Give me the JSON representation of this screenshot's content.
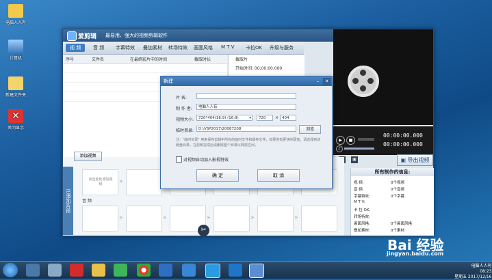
{
  "desktop": {
    "icons": [
      {
        "label": "电脑人人有",
        "name": "desktop-icon-folder"
      },
      {
        "label": "计算机",
        "name": "desktop-icon-computer"
      },
      {
        "label": "新建文件夹",
        "name": "desktop-icon-new-folder"
      },
      {
        "label": "关闭显示",
        "name": "desktop-icon-close-display"
      }
    ]
  },
  "app": {
    "title": "爱剪辑",
    "slogan": "最易用、强大的视频剪辑软件",
    "menu": [
      "视 频",
      "音 频",
      "字幕特效",
      "叠加素材",
      "转场特效",
      "画面风格",
      "M T V",
      "卡拉OK",
      "升级与服务"
    ],
    "table_headers": [
      "序号",
      "文件名",
      "在最终影片中的时间",
      "截取时长"
    ],
    "right_panel_title": "截取片",
    "right_panel_start": "开始时间: 00:00:00.000",
    "time_current": "00:00:00.000",
    "time_total": "00:00:00.000",
    "export_label": "导出视频",
    "add_video": "添加视频",
    "side_tab": "已添加片段",
    "thumb_hint": "双击此处添加视频",
    "music_label": "音 频",
    "info_title": "所有制作的信息:",
    "info_rows": [
      {
        "k": "视     频:",
        "v": "0个视频"
      },
      {
        "k": "音     频:",
        "v": "0个音频"
      },
      {
        "k": "字幕特效:",
        "v": "0个字幕"
      },
      {
        "k": "M     T     V:",
        "v": ""
      },
      {
        "k": "卡  拉  OK:",
        "v": ""
      },
      {
        "k": "转场特效:",
        "v": ""
      },
      {
        "k": "画面风格:",
        "v": "0个画面风格"
      },
      {
        "k": "叠加素材:",
        "v": "0个素材"
      }
    ]
  },
  "dialog": {
    "title": "新建",
    "name_label": "片      名:",
    "name_value": "",
    "author_label": "制  作  者:",
    "author_value": "电脑人人有",
    "size_label": "视频大小:",
    "size_value": "720*404(16:9) (16:9)",
    "width_value": "720",
    "height_value": "404",
    "dir_label": "临时目录:",
    "dir_value": "D:\\VSP2017\\20087208",
    "browse": "浏览",
    "tip": "注：\"临时目录\" 用来保存剪辑中所有的临时文件和缓存文件，如果你有更快的硬盘，请选择到该硬盘目录，在剪辑完成后请删除整个目录以释放空间。",
    "checkbox_label": "对视频自动加入影视特效",
    "ok": "确 定",
    "cancel": "取 消"
  },
  "taskbar": {
    "tray_line1": "电脑人人有",
    "tray_time": "08:23",
    "tray_date": "星期五 2017/12/16"
  },
  "watermark": {
    "brand": "Bai 经验",
    "url": "jingyan.baidu.com"
  },
  "colors": {
    "accent": "#3d7fc4",
    "title_bar": "#2a5684",
    "desktop": "#1b5d9e"
  }
}
